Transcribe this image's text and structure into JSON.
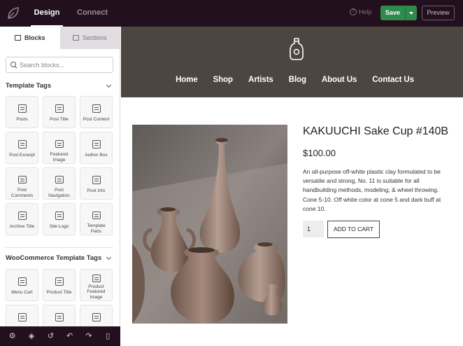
{
  "topbar": {
    "tabs": [
      {
        "label": "Design"
      },
      {
        "label": "Connect"
      }
    ],
    "help_label": "Help",
    "help_icon": "help-circle-icon",
    "save_label": "Save",
    "preview_label": "Preview",
    "accent_color": "#2f8a4c",
    "bar_color": "#23101f"
  },
  "sidebar": {
    "tabs": [
      {
        "label": "Blocks",
        "icon": "blocks-icon"
      },
      {
        "label": "Sections",
        "icon": "sections-icon"
      }
    ],
    "search": {
      "placeholder": "Search blocks..."
    },
    "sections": [
      {
        "title": "Template Tags",
        "blocks": [
          {
            "label": "Posts"
          },
          {
            "label": "Post Title"
          },
          {
            "label": "Post Content"
          },
          {
            "label": "Post Excerpt"
          },
          {
            "label": "Featured Image"
          },
          {
            "label": "Author Box"
          },
          {
            "label": "Post Comments"
          },
          {
            "label": "Post Navigation"
          },
          {
            "label": "Post Info"
          },
          {
            "label": "Archive Title"
          },
          {
            "label": "Site Logo"
          },
          {
            "label": "Template Parts"
          }
        ]
      },
      {
        "title": "WooCommerce Template Tags",
        "blocks": [
          {
            "label": "Menu Cart"
          },
          {
            "label": "Product Title"
          },
          {
            "label": "Product Featured Image"
          },
          {
            "label": ""
          },
          {
            "label": ""
          },
          {
            "label": ""
          }
        ]
      }
    ],
    "bottom_icons": [
      "settings-icon",
      "layers-icon",
      "history-icon",
      "undo-icon",
      "redo-icon",
      "mobile-preview-icon"
    ]
  },
  "site": {
    "logo_icon": "bottle-logo-icon",
    "nav": [
      "Home",
      "Shop",
      "Artists",
      "Blog",
      "About Us",
      "Contact Us"
    ],
    "header_color": "#4d4540"
  },
  "product": {
    "title": "KAKUUCHI Sake Cup #140B",
    "price": "$100.00",
    "description": "An all-purpose off-white plastic clay formulated to be versatile and strong, No. 11 is suitable for all handbuilding methods, modeling, & wheel throwing. Cone 5-10. Off white color at cone 5 and dark buff at cone 10.",
    "quantity": "1",
    "add_to_cart_label": "ADD TO CART"
  }
}
